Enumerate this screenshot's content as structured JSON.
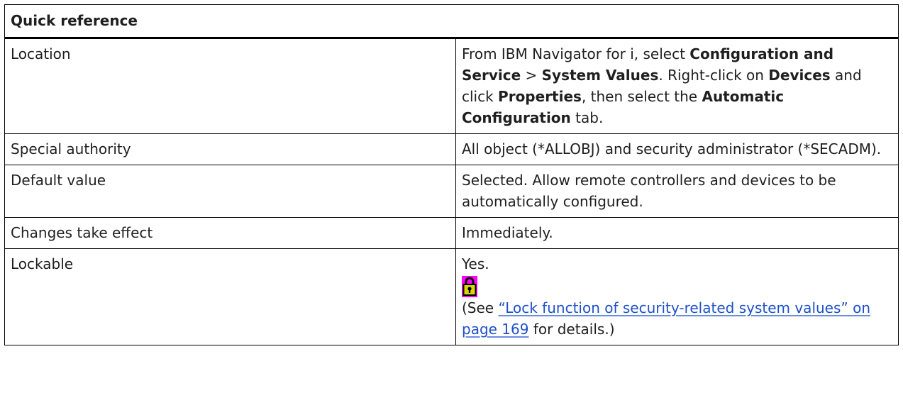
{
  "table": {
    "header": "Quick reference",
    "rows": [
      {
        "label": "Location",
        "value": {
          "t1": "From IBM Navigator for i, select ",
          "b1": "Configuration and Service",
          "t2": " > ",
          "b2": "System Values",
          "t3": ". Right-click on ",
          "b3": "Devices",
          "t4": " and click ",
          "b4": "Properties",
          "t5": ", then select the ",
          "b5": "Automatic Configuration",
          "t6": " tab."
        }
      },
      {
        "label": "Special authority",
        "value": "All object (*ALLOBJ) and security administrator (*SECADM)."
      },
      {
        "label": "Default value",
        "value": "Selected. Allow remote controllers and devices to be automatically configured."
      },
      {
        "label": "Changes take effect",
        "value": "Immediately."
      },
      {
        "label": "Lockable",
        "value": {
          "text": "Yes.",
          "icon": "lock-icon",
          "note_open": "(See ",
          "link": "“Lock function of security-related system values” on page 169",
          "note_close": " for details.)"
        }
      }
    ]
  },
  "colors": {
    "border": "#000000",
    "link": "#1e50c8",
    "icon_background": "#ff00ff",
    "icon_body": "#d8d800"
  }
}
